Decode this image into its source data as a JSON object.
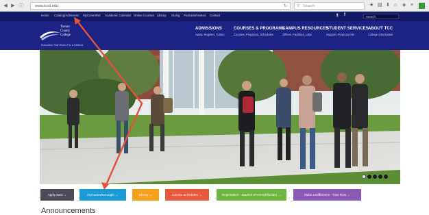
{
  "browser": {
    "url": "www.tccd.edu",
    "search_placeholder": "Search",
    "back_icon": "back-arrow-icon",
    "forward_icon": "forward-arrow-icon"
  },
  "topnav": {
    "links": [
      "Home",
      "Catalog/Admission",
      "MyCommRet",
      "Academic Calendar",
      "Online Courses",
      "Library",
      "Giving",
      "Podcasts/Videos",
      "Contact"
    ],
    "social": [
      "twitter-icon",
      "facebook-icon"
    ],
    "search_label": "Search"
  },
  "header": {
    "logo_lines": [
      "Tarrant",
      "County",
      "College"
    ],
    "tagline": "Education That Works For a Lifetime",
    "nav": [
      {
        "title": "ADMISSIONS",
        "sub": "Apply, Register, Tuition"
      },
      {
        "title": "COURSES & PROGRAMS",
        "sub": "Courses, Programs, Schedules"
      },
      {
        "title": "CAMPUS RESOURCES",
        "sub": "Offices, Facilities, Labs"
      },
      {
        "title": "STUDENT SERVICES",
        "sub": "Support, Financial Aid"
      },
      {
        "title": "ABOUT TCC",
        "sub": "College Information"
      }
    ]
  },
  "quick_links": [
    {
      "label": "Apply Now →",
      "color": "#4b4b57"
    },
    {
      "label": "myCommRet Login →",
      "color": "#1c9ad6"
    },
    {
      "label": "Library →",
      "color": "#f3a11c"
    },
    {
      "label": "Course Schedules →",
      "color": "#e8593b"
    },
    {
      "label": "Registration - Student eForms(Ellucian) →",
      "color": "#6fb640"
    },
    {
      "label": "Make a Difference - Give Now →",
      "color": "#8a5ab6"
    }
  ],
  "announcements_heading": "Announcements",
  "colors": {
    "topnav_bg": "#151a66",
    "header_bg": "#1d2285",
    "annotation_arrow": "#e0533a"
  }
}
